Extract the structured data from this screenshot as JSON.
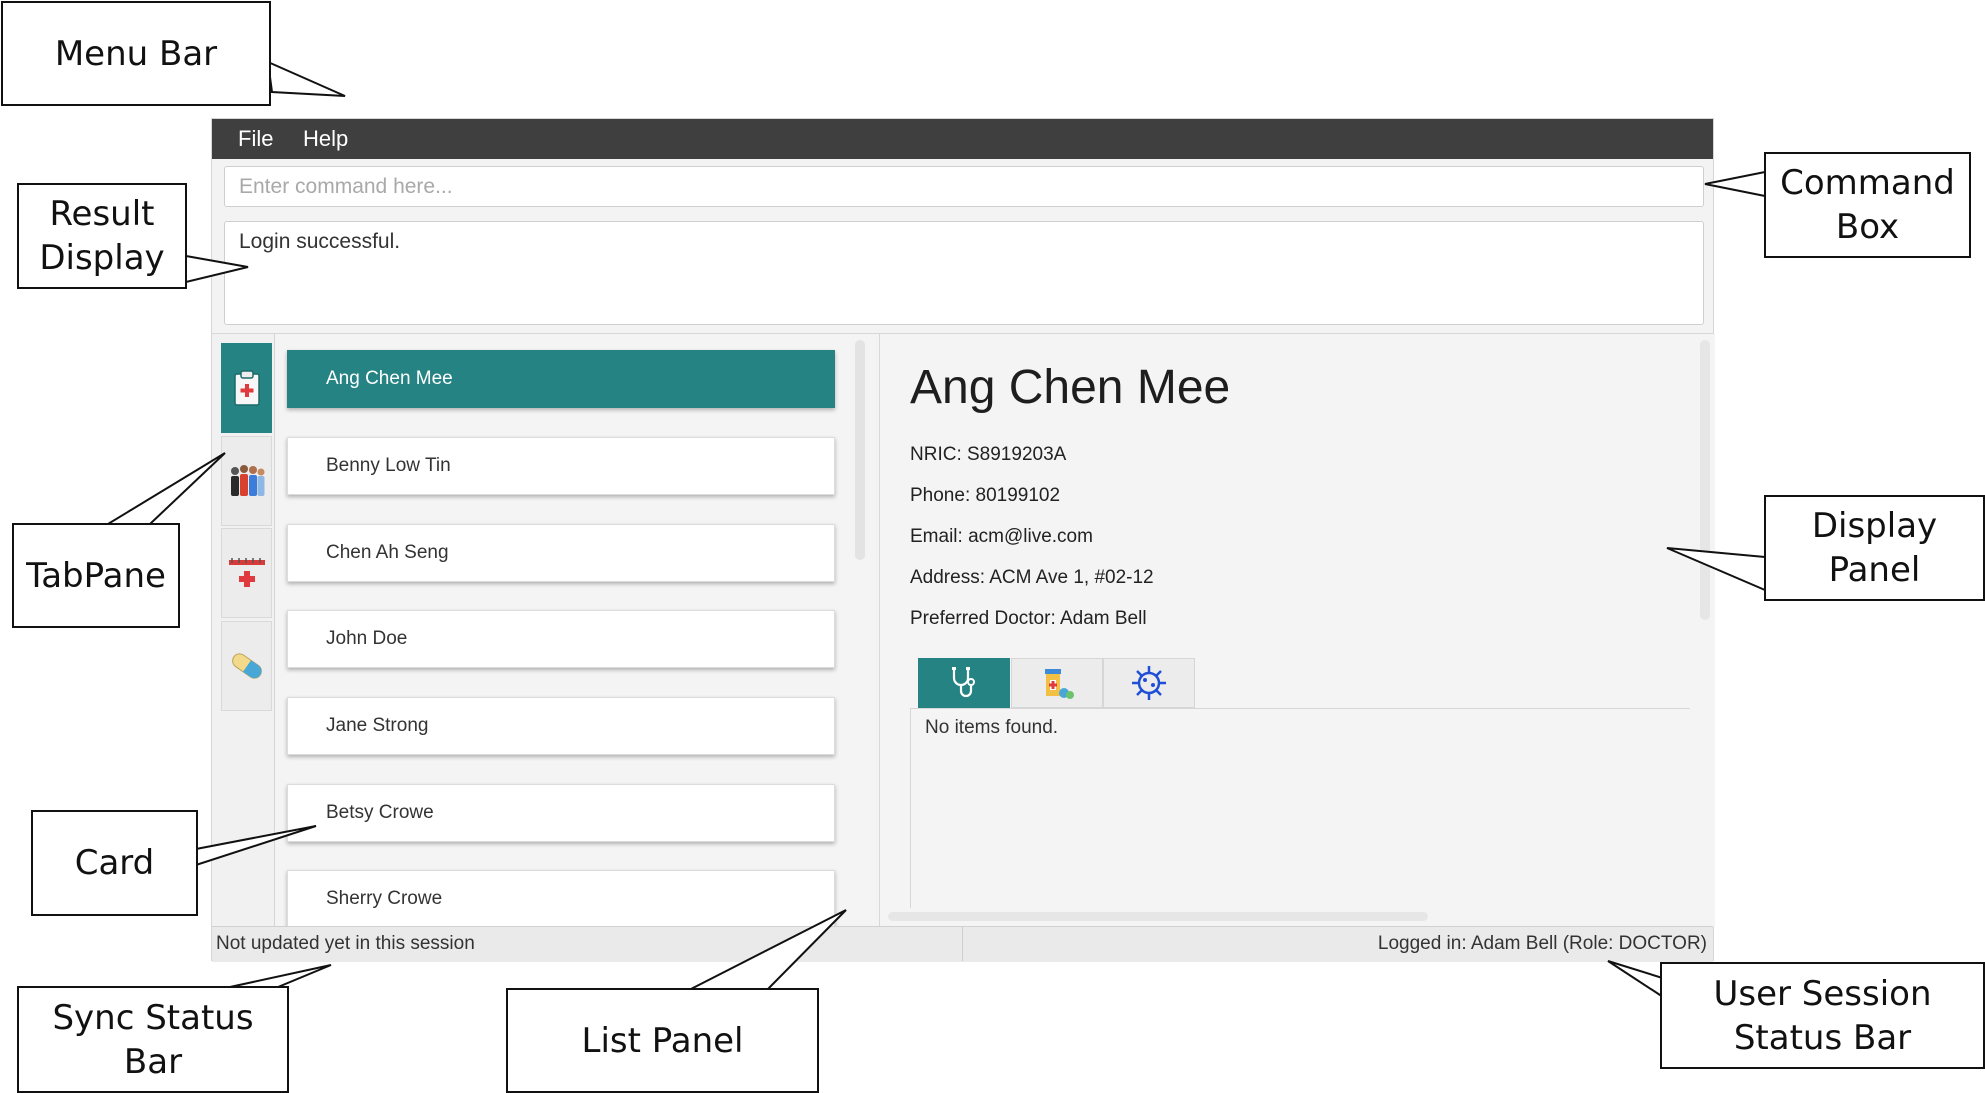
{
  "callouts": {
    "menu_bar": "Menu Bar",
    "command_box": "Command\nBox",
    "result_display": "Result\nDisplay",
    "tabpane": "TabPane",
    "display_panel": "Display\nPanel",
    "card": "Card",
    "sync_status_bar": "Sync Status Bar",
    "list_panel": "List Panel",
    "user_session_status_bar": "User Session\nStatus Bar"
  },
  "menu": {
    "items": [
      "File",
      "Help"
    ]
  },
  "command": {
    "placeholder": "Enter command here...",
    "value": ""
  },
  "result": {
    "text": "Login successful."
  },
  "tabs": [
    {
      "icon": "clipboard-icon",
      "active": true
    },
    {
      "icon": "people-icon",
      "active": false
    },
    {
      "icon": "calendar-medical-icon",
      "active": false
    },
    {
      "icon": "pill-icon",
      "active": false
    }
  ],
  "list": {
    "items": [
      "Ang Chen Mee",
      "Benny Low Tin",
      "Chen Ah Seng",
      "John Doe",
      "Jane Strong",
      "Betsy Crowe",
      "Sherry Crowe"
    ],
    "selected_index": 0
  },
  "display": {
    "name": "Ang Chen Mee",
    "nric": "NRIC: S8919203A",
    "phone": "Phone: 80199102",
    "email": "Email: acm@live.com",
    "address": "Address: ACM Ave 1, #02-12",
    "preferred_doctor": "Preferred Doctor: Adam Bell",
    "tabs": [
      {
        "icon": "stethoscope-icon",
        "active": true
      },
      {
        "icon": "medicine-icon",
        "active": false
      },
      {
        "icon": "virus-icon",
        "active": false
      }
    ],
    "empty_text": "No items found."
  },
  "status": {
    "sync": "Not updated yet in this session",
    "session": "Logged in: Adam Bell (Role: DOCTOR)"
  },
  "colors": {
    "accent": "#258383",
    "menubar": "#3f3f3f",
    "virus": "#1f4fd6",
    "pill": "#48a7d6"
  }
}
